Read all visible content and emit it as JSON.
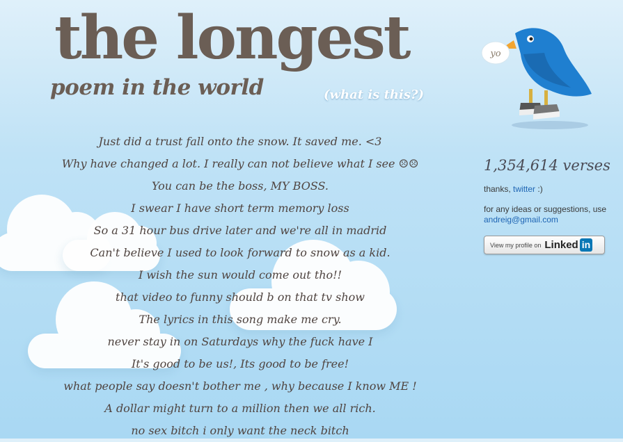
{
  "header": {
    "title": "the longest",
    "subtitle": "poem in the world",
    "what_is_link": "(what is this?)"
  },
  "bird": {
    "speech": "yo"
  },
  "poem": {
    "lines": [
      "Just did a trust fall onto the snow. It saved me. <3",
      "Why have changed a lot. I really can not believe what I see ☹☹",
      "You can be the boss, MY BOSS.",
      "I swear I have short term memory loss",
      "So a 31 hour bus drive later and we're all in madrid",
      "Can't believe I used to look forward to snow as a kid.",
      "I wish the sun would come out tho!!",
      "that video to funny should b on that tv show",
      "The lyrics in this song make me cry.",
      "never stay in on Saturdays why the fuck have I",
      "It's good to be us!, Its good to be free!",
      "what people say doesn't bother me , why because I know ME !",
      "A dollar might turn to a million then we all rich.",
      "no sex bitch i only want the neck bitch"
    ]
  },
  "sidebar": {
    "verses": "1,354,614 verses",
    "thanks_prefix": "thanks,",
    "thanks_link": "twitter",
    "thanks_suffix": ":)",
    "ideas_text": "for any ideas or suggestions, use",
    "email": "andreig@gmail.com",
    "linkedin": {
      "small": "View my profile on",
      "word": "Linked",
      "in": "in"
    }
  },
  "colors": {
    "title": "#6b5e55",
    "poem_text": "#4f4440",
    "link": "#1d64b3",
    "bird": "#1f7fd0",
    "sky_top": "#dff0fa",
    "sky_bottom": "#a9d8f3"
  },
  "icons": [
    "twitter-bird-icon",
    "linkedin-logo-icon"
  ]
}
